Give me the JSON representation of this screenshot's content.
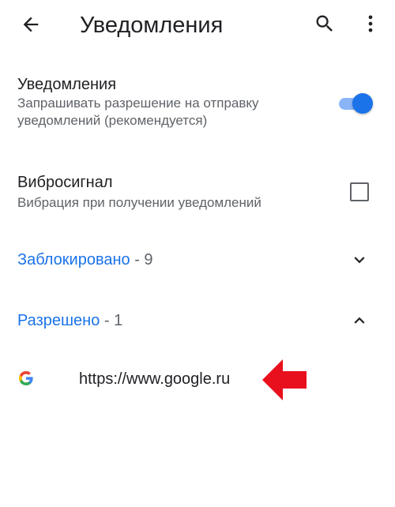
{
  "colors": {
    "accent": "#1a73e8",
    "toggle_thumb": "#1a73e8",
    "toggle_track": "#8ab4f8",
    "arrow": "#e8101d"
  },
  "appbar": {
    "title": "Уведомления",
    "back_icon": "arrow-back-icon",
    "search_icon": "search-icon",
    "more_icon": "more-vert-icon"
  },
  "settings": {
    "notifications": {
      "title": "Уведомления",
      "subtitle": "Запрашивать разрешение на отправку уведомлений (рекомендуется)",
      "enabled": true
    },
    "vibration": {
      "title": "Вибросигнал",
      "subtitle": "Вибрация при получении уведомлений",
      "checked": false
    }
  },
  "groups": {
    "blocked": {
      "label": "Заблокировано",
      "count": " - 9",
      "expanded": false
    },
    "allowed": {
      "label": "Разрешено",
      "count": " - 1",
      "expanded": true
    }
  },
  "sites": [
    {
      "url": "https://www.google.ru",
      "favicon": "google-g-icon"
    }
  ],
  "annotation": {
    "icon": "red-arrow-left-icon"
  }
}
